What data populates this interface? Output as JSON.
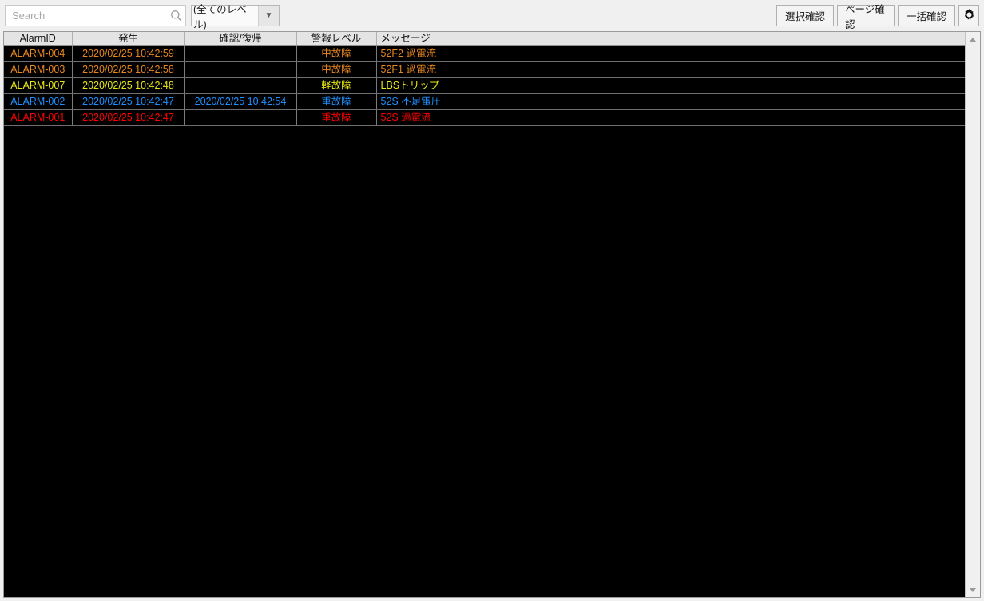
{
  "toolbar": {
    "search": {
      "placeholder": "Search",
      "value": "",
      "icon": "search-icon"
    },
    "level_filter": {
      "selected": "(全てのレベル)",
      "arrow_glyph": "▼",
      "options": [
        "(全てのレベル)"
      ]
    },
    "buttons": [
      {
        "id": "select-confirm",
        "label": "選択確認"
      },
      {
        "id": "page-confirm",
        "label": "ページ確認"
      },
      {
        "id": "bulk-confirm",
        "label": "一括確認"
      }
    ],
    "settings_button": {
      "icon": "gear-icon",
      "label": ""
    }
  },
  "table": {
    "columns": [
      {
        "key": "alarm_id",
        "label": "AlarmID",
        "align": "center"
      },
      {
        "key": "occurred",
        "label": "発生",
        "align": "center"
      },
      {
        "key": "ack",
        "label": "確認/復帰",
        "align": "center"
      },
      {
        "key": "level",
        "label": "警報レベル",
        "align": "center"
      },
      {
        "key": "message",
        "label": "メッセージ",
        "align": "left"
      }
    ],
    "rows": [
      {
        "alarm_id": "ALARM-004",
        "occurred": "2020/02/25 10:42:59",
        "ack": "",
        "level": "中故障",
        "message": "52F2 過電流",
        "color": "#e8861e"
      },
      {
        "alarm_id": "ALARM-003",
        "occurred": "2020/02/25 10:42:58",
        "ack": "",
        "level": "中故障",
        "message": "52F1 過電流",
        "color": "#e8861e"
      },
      {
        "alarm_id": "ALARM-007",
        "occurred": "2020/02/25 10:42:48",
        "ack": "",
        "level": "軽故障",
        "message": "LBSトリップ",
        "color": "#e8e812"
      },
      {
        "alarm_id": "ALARM-002",
        "occurred": "2020/02/25 10:42:47",
        "ack": "2020/02/25 10:42:54",
        "level": "重故障",
        "message": "52S 不足電圧",
        "color": "#1e90ff"
      },
      {
        "alarm_id": "ALARM-001",
        "occurred": "2020/02/25 10:42:47",
        "ack": "",
        "level": "重故障",
        "message": "52S 過電流",
        "color": "#ff0000"
      }
    ]
  },
  "scrollbar": {
    "up_arrow": "▲",
    "down_arrow": "▼"
  },
  "colors": {
    "background": "#f0f0f0",
    "table_background": "#000000",
    "header_background": "#e4e4e4",
    "grid_line": "#6e6e6e",
    "severity_major": "#ff0000",
    "severity_major_alt": "#1e90ff",
    "severity_medium": "#e8861e",
    "severity_minor": "#e8e812"
  }
}
